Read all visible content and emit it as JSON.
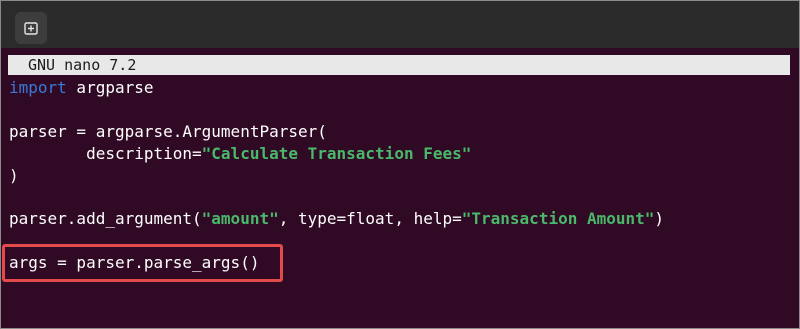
{
  "window": {
    "new_tab_icon": "new-tab-plus-icon"
  },
  "nano": {
    "header": "GNU nano 7.2"
  },
  "code": {
    "l1_kw": "import",
    "l1_rest": " argparse",
    "l3": "parser = argparse.ArgumentParser(",
    "l4_pre": "        description=",
    "l4_str": "\"Calculate Transaction Fees\"",
    "l5": ")",
    "l7_a": "parser.add_argument(",
    "l7_str1": "\"amount\"",
    "l7_b": ", type=float, help=",
    "l7_str2": "\"Transaction Amount\"",
    "l7_c": ")",
    "l9": "args = parser.parse_args()"
  },
  "colors": {
    "terminal_bg": "#300a24",
    "keyword": "#3c78d8",
    "string": "#4ab86b",
    "highlight": "#e34b4b"
  }
}
